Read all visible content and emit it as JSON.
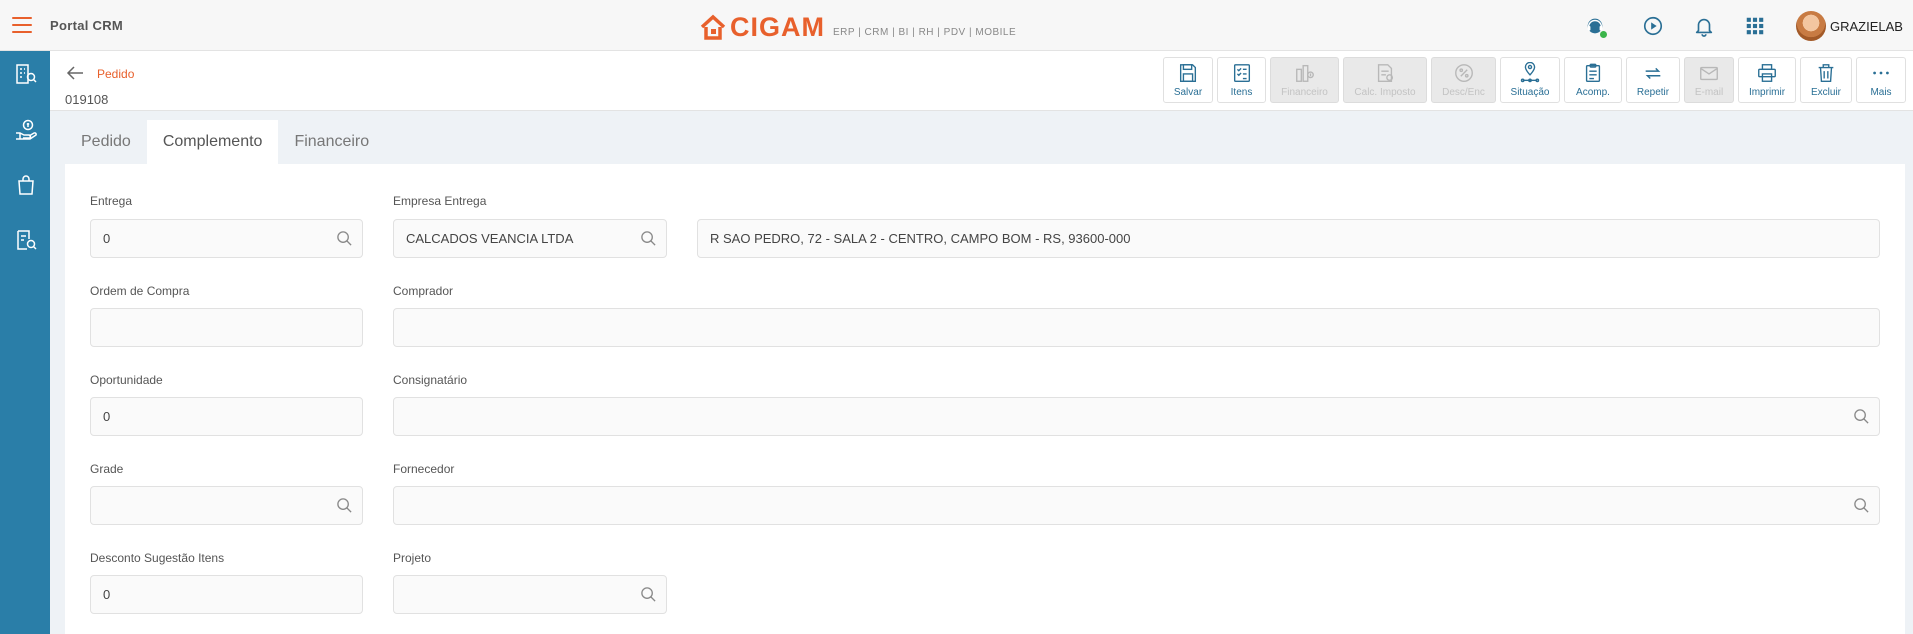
{
  "header": {
    "portal_title": "Portal CRM",
    "logo_text": "CIGAM",
    "logo_subtitle": "ERP | CRM | BI | RH | PDV | MOBILE",
    "username": "GRAZIELAB",
    "accent_color": "#e8602c",
    "sidebar_color": "#2a7ea8"
  },
  "sidebar": {
    "items": [
      {
        "icon": "building-search-icon"
      },
      {
        "icon": "hand-money-icon"
      },
      {
        "icon": "shopping-bag-icon"
      },
      {
        "icon": "document-search-icon"
      }
    ]
  },
  "page": {
    "breadcrumb": "Pedido",
    "doc_number": "019108"
  },
  "toolbar": {
    "buttons": [
      {
        "label": "Salvar",
        "icon": "save-icon",
        "enabled": true
      },
      {
        "label": "Itens",
        "icon": "checklist-icon",
        "enabled": true
      },
      {
        "label": "Financeiro",
        "icon": "finance-icon",
        "enabled": false
      },
      {
        "label": "Calc. Imposto",
        "icon": "tax-calc-icon",
        "enabled": false
      },
      {
        "label": "Desc/Enc",
        "icon": "percent-icon",
        "enabled": false
      },
      {
        "label": "Situação",
        "icon": "location-pin-icon",
        "enabled": true
      },
      {
        "label": "Acomp.",
        "icon": "clipboard-icon",
        "enabled": true
      },
      {
        "label": "Repetir",
        "icon": "repeat-icon",
        "enabled": true
      },
      {
        "label": "E-mail",
        "icon": "email-icon",
        "enabled": false
      },
      {
        "label": "Imprimir",
        "icon": "printer-icon",
        "enabled": true
      },
      {
        "label": "Excluir",
        "icon": "trash-icon",
        "enabled": true
      },
      {
        "label": "Mais",
        "icon": "more-icon",
        "enabled": true
      }
    ]
  },
  "tabs": [
    {
      "label": "Pedido",
      "active": false
    },
    {
      "label": "Complemento",
      "active": true
    },
    {
      "label": "Financeiro",
      "active": false
    }
  ],
  "form": {
    "entrega": {
      "label": "Entrega",
      "value": "0"
    },
    "empresa_entrega": {
      "label": "Empresa Entrega",
      "value": "CALCADOS VEANCIA LTDA"
    },
    "endereco": {
      "value": "R SAO PEDRO, 72 - SALA  2 - CENTRO, CAMPO BOM - RS, 93600-000"
    },
    "ordem_compra": {
      "label": "Ordem de Compra",
      "value": ""
    },
    "comprador": {
      "label": "Comprador",
      "value": ""
    },
    "oportunidade": {
      "label": "Oportunidade",
      "value": "0"
    },
    "consignatario": {
      "label": "Consignatário",
      "value": ""
    },
    "grade": {
      "label": "Grade",
      "value": ""
    },
    "fornecedor": {
      "label": "Fornecedor",
      "value": ""
    },
    "desconto": {
      "label": "Desconto Sugestão Itens",
      "value": "0"
    },
    "projeto": {
      "label": "Projeto",
      "value": ""
    }
  }
}
